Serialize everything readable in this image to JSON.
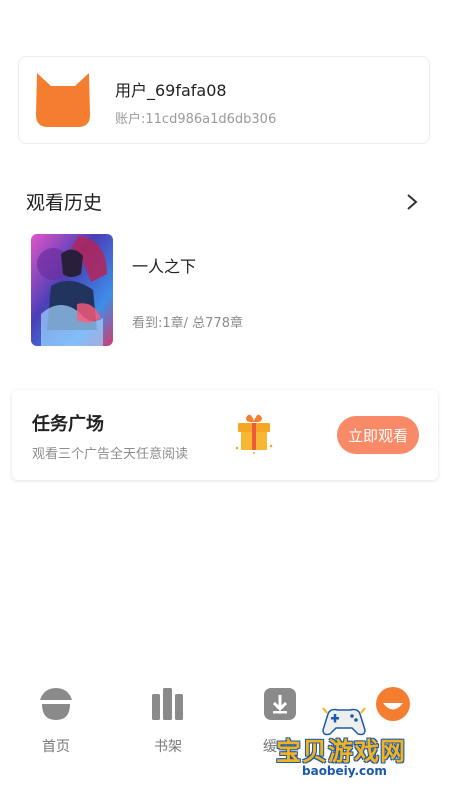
{
  "profile": {
    "name": "用户_69fafa08",
    "account_id": "账户:11cd986a1d6db306",
    "avatar_icon": "cat-avatar-icon",
    "avatar_color": "#f47d2f"
  },
  "history": {
    "title": "观看历史",
    "more_icon": "chevron-right-icon",
    "items": [
      {
        "title": "一人之下",
        "progress": "看到:1章/ 总778章"
      }
    ]
  },
  "task": {
    "title": "任务广场",
    "description": "观看三个广告全天任意阅读",
    "button_label": "立即观看",
    "icon": "gift-icon",
    "button_color": "#f98a67"
  },
  "nav": {
    "items": [
      {
        "label": "首页",
        "icon": "home-acorn-icon"
      },
      {
        "label": "书架",
        "icon": "bookshelf-icon"
      },
      {
        "label": "缓",
        "icon": "download-icon"
      },
      {
        "label": "",
        "icon": "profile-face-icon"
      }
    ],
    "active_color": "#f47d2f"
  },
  "watermark": {
    "text": "宝贝游戏网",
    "url": "baobeiy.com"
  }
}
